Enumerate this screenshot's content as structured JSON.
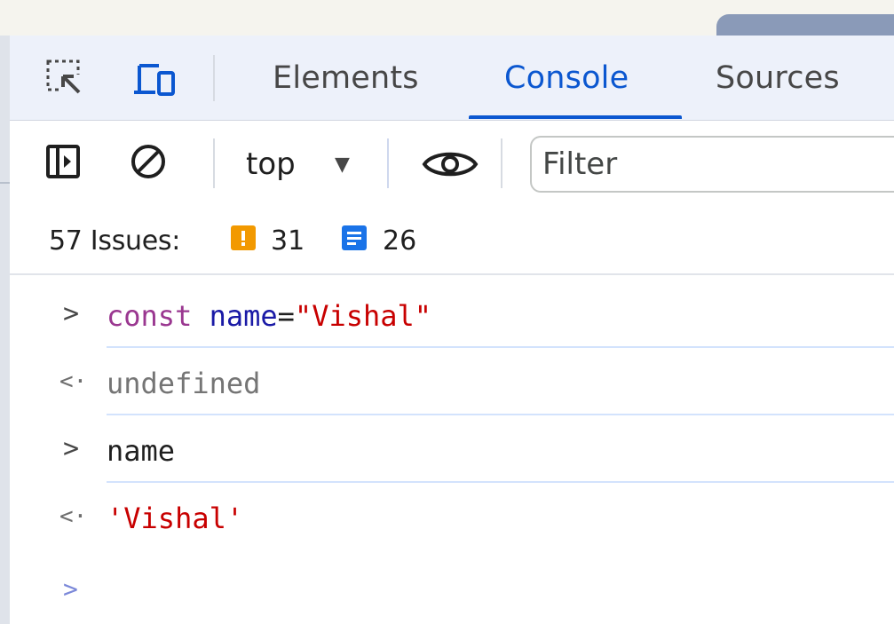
{
  "devtools": {
    "tabs": [
      {
        "label": "Elements"
      },
      {
        "label": "Console"
      },
      {
        "label": "Sources"
      }
    ],
    "toolbar": {
      "context": "top",
      "filter_placeholder": "Filter"
    },
    "issues": {
      "label": "57 Issues:",
      "warnings": "31",
      "info": "26"
    },
    "console": {
      "entries": [
        {
          "kind": "input",
          "keyword": "const",
          "variable": "name",
          "operator": "=",
          "string": "\"Vishal\""
        },
        {
          "kind": "result",
          "text": "undefined"
        },
        {
          "kind": "input",
          "text": "name"
        },
        {
          "kind": "result",
          "string": "'Vishal'"
        }
      ]
    }
  },
  "colors": {
    "accent": "#0b57d0",
    "keyword": "#9a3790",
    "variable": "#1a1aa6",
    "string": "#c80000",
    "issue_warning": "#f29900",
    "issue_info": "#1a73e8"
  },
  "icons": [
    "inspect-element-icon",
    "device-toolbar-icon",
    "sidebar-toggle-icon",
    "clear-console-icon",
    "dropdown-caret-icon",
    "eye-icon",
    "warning-badge-icon",
    "info-badge-icon"
  ]
}
